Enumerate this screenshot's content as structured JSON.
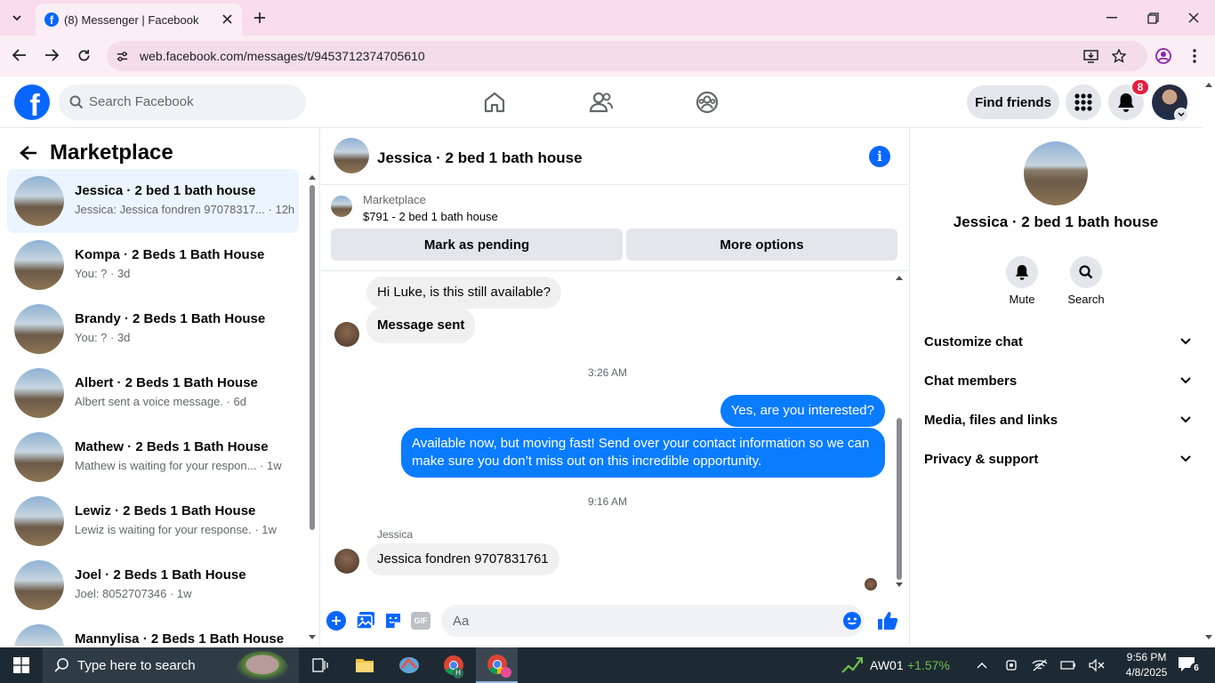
{
  "browser": {
    "tab_title": "(8) Messenger | Facebook",
    "url": "web.facebook.com/messages/t/9453712374705610"
  },
  "fb": {
    "search_placeholder": "Search Facebook",
    "find_friends": "Find friends",
    "notifications_count": "8"
  },
  "left": {
    "title": "Marketplace",
    "conversations": [
      {
        "name": "Jessica · 2 bed 1 bath house",
        "preview": "Jessica: Jessica fondren 97078317... · 12h"
      },
      {
        "name": "Kompa · 2 Beds 1 Bath House",
        "preview": "You: ? · 3d"
      },
      {
        "name": "Brandy · 2 Beds 1 Bath House",
        "preview": "You: ? · 3d"
      },
      {
        "name": "Albert · 2 Beds 1 Bath House",
        "preview": "Albert sent a voice message. · 6d"
      },
      {
        "name": "Mathew · 2 Beds 1 Bath House",
        "preview": "Mathew is waiting for your respon... · 1w"
      },
      {
        "name": "Lewiz · 2 Beds 1 Bath House",
        "preview": "Lewiz is waiting for your response. · 1w"
      },
      {
        "name": "Joel · 2 Beds 1 Bath House",
        "preview": "Joel: 8052707346 · 1w"
      },
      {
        "name": "Mannylisa · 2 Beds 1 Bath House",
        "preview": ""
      }
    ]
  },
  "chat": {
    "title": "Jessica · 2 bed 1 bath house",
    "listing_source": "Marketplace",
    "listing_price_title": "$791 - 2 bed 1 bath house",
    "mark_pending": "Mark as pending",
    "more_options": "More options",
    "messages": [
      {
        "side": "left",
        "text": "Hi Luke, is this still available?"
      },
      {
        "side": "left",
        "text": "Message sent"
      },
      {
        "time": "3:26 AM"
      },
      {
        "side": "right",
        "text": "Yes, are you interested?"
      },
      {
        "side": "right",
        "text": "Available now, but moving fast! Send over your contact information so we can make sure you don’t miss out on this incredible opportunity."
      },
      {
        "time": "9:16 AM"
      },
      {
        "sender": "Jessica"
      },
      {
        "side": "left",
        "text": "Jessica fondren 9707831761"
      }
    ],
    "composer_placeholder": "Aa",
    "gif_label": "GIF"
  },
  "right": {
    "name": "Jessica · 2 bed 1 bath house",
    "mute_label": "Mute",
    "search_label": "Search",
    "sections": [
      "Customize chat",
      "Chat members",
      "Media, files and links",
      "Privacy & support"
    ]
  },
  "taskbar": {
    "search_placeholder": "Type here to search",
    "stock_name": "AW01",
    "stock_change": "+1.57%",
    "time": "9:56 PM",
    "date": "4/8/2025",
    "notif_count": "6"
  },
  "colors": {
    "fb_blue": "#0866ff",
    "messenger_blue": "#0a7cff",
    "badge_red": "#e41e3f"
  }
}
